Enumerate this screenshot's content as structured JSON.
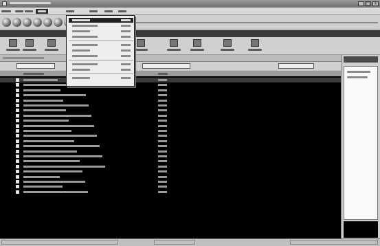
{
  "window": {
    "title": "",
    "min_glyph": "_",
    "max_glyph": "□",
    "close_glyph": "×"
  },
  "menubar": {
    "items": [
      {
        "label": ""
      },
      {
        "label": ""
      },
      {
        "label": ""
      },
      {
        "label": ""
      },
      {
        "label": ""
      },
      {
        "label": ""
      },
      {
        "label": ""
      },
      {
        "label": ""
      }
    ],
    "active_index": 3
  },
  "dropdown": {
    "items": [
      {
        "label": "",
        "shortcut": ""
      },
      {
        "label": "",
        "shortcut": ""
      },
      {
        "label": "",
        "shortcut": ""
      },
      {
        "label": "",
        "shortcut": ""
      },
      {
        "separator": true
      },
      {
        "label": "",
        "shortcut": ""
      },
      {
        "label": "",
        "shortcut": ""
      },
      {
        "label": "",
        "shortcut": ""
      },
      {
        "separator": true
      },
      {
        "label": "",
        "shortcut": ""
      },
      {
        "label": "",
        "shortcut": ""
      },
      {
        "separator": true
      },
      {
        "label": "",
        "shortcut": ""
      }
    ],
    "highlight_index": 0
  },
  "player_buttons": [
    "play-icon",
    "stop-icon",
    "prev-icon",
    "next-icon",
    "shuffle-icon",
    "repeat-icon",
    "record-icon"
  ],
  "toolbar": [
    {
      "icon": "play-icon",
      "label": ""
    },
    {
      "icon": "stop-icon",
      "label": ""
    },
    {
      "icon": "record-icon",
      "label": ""
    },
    {
      "icon": "edit-icon",
      "label": ""
    },
    {
      "icon": "new-icon",
      "label": ""
    },
    {
      "icon": "open-icon",
      "label": ""
    },
    {
      "icon": "save-icon",
      "label": ""
    },
    {
      "icon": "print-icon",
      "label": ""
    },
    {
      "icon": "find-icon",
      "label": ""
    },
    {
      "icon": "help-icon",
      "label": ""
    }
  ],
  "path": "",
  "fields": [
    {
      "label": "",
      "value": ""
    },
    {
      "label": "",
      "value": ""
    },
    {
      "label": "",
      "value": ""
    }
  ],
  "columns": [
    "",
    "",
    ""
  ],
  "tracks": [
    {
      "name": "",
      "length": ""
    },
    {
      "name": "",
      "length": ""
    },
    {
      "name": "",
      "length": ""
    },
    {
      "name": "",
      "length": ""
    },
    {
      "name": "",
      "length": ""
    },
    {
      "name": "",
      "length": ""
    },
    {
      "name": "",
      "length": ""
    },
    {
      "name": "",
      "length": ""
    },
    {
      "name": "",
      "length": ""
    },
    {
      "name": "",
      "length": ""
    },
    {
      "name": "",
      "length": ""
    },
    {
      "name": "",
      "length": ""
    },
    {
      "name": "",
      "length": ""
    },
    {
      "name": "",
      "length": ""
    },
    {
      "name": "",
      "length": ""
    },
    {
      "name": "",
      "length": ""
    },
    {
      "name": "",
      "length": ""
    },
    {
      "name": "",
      "length": ""
    },
    {
      "name": "",
      "length": ""
    },
    {
      "name": "",
      "length": ""
    },
    {
      "name": "",
      "length": ""
    },
    {
      "name": "",
      "length": ""
    },
    {
      "name": "",
      "length": ""
    }
  ],
  "right_pane": {
    "title": "",
    "items": [
      "",
      ""
    ]
  },
  "status": [
    "",
    "",
    ""
  ]
}
